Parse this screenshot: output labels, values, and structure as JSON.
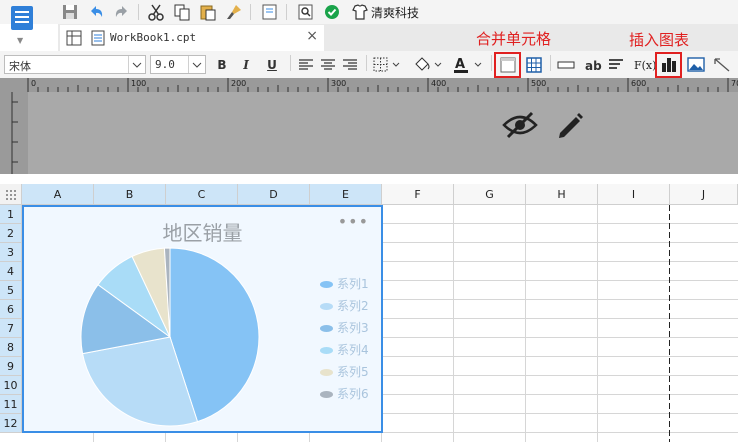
{
  "toolbar": {
    "brand_name": "清爽科技"
  },
  "tab": {
    "filename": "WorkBook1.cpt",
    "close": "×"
  },
  "annotations": {
    "merge_cells": "合并单元格",
    "insert_chart": "插入图表"
  },
  "format": {
    "font_name": "宋体",
    "font_size": "9.0",
    "bold": "B",
    "italic": "I",
    "underline": "U",
    "formula": "F(x)",
    "text_ab": "ab"
  },
  "ruler": {
    "marks": [
      "0",
      "100",
      "200",
      "300",
      "400",
      "500",
      "600",
      "700"
    ]
  },
  "sheet": {
    "columns": [
      "A",
      "B",
      "C",
      "D",
      "E",
      "F",
      "G",
      "H",
      "I",
      "J"
    ],
    "rows": [
      "1",
      "2",
      "3",
      "4",
      "5",
      "6",
      "7",
      "8",
      "9",
      "10",
      "11",
      "12"
    ],
    "selected_columns": [
      "A",
      "B",
      "C",
      "D",
      "E"
    ]
  },
  "chart": {
    "title": "地区销量",
    "more": "•••",
    "legend": [
      {
        "label": "系列1",
        "color": "#85c3f5"
      },
      {
        "label": "系列2",
        "color": "#b7dcf7"
      },
      {
        "label": "系列3",
        "color": "#8bbfe9"
      },
      {
        "label": "系列4",
        "color": "#a9dcf7"
      },
      {
        "label": "系列5",
        "color": "#e8e3cc"
      },
      {
        "label": "系列6",
        "color": "#aab4bf"
      }
    ]
  },
  "chart_data": {
    "type": "pie",
    "title": "地区销量",
    "series": [
      {
        "name": "系列1",
        "value": 45,
        "color": "#85c3f5"
      },
      {
        "name": "系列2",
        "value": 27,
        "color": "#b7dcf7"
      },
      {
        "name": "系列3",
        "value": 13,
        "color": "#8bbfe9"
      },
      {
        "name": "系列4",
        "value": 8,
        "color": "#a9dcf7"
      },
      {
        "name": "系列5",
        "value": 6,
        "color": "#e8e3cc"
      },
      {
        "name": "系列6",
        "value": 1,
        "color": "#aab4bf"
      }
    ],
    "legend_position": "right"
  },
  "colors": {
    "accent": "#3a8ee6",
    "annotation": "#e02020",
    "selection": "#cde5f8"
  }
}
